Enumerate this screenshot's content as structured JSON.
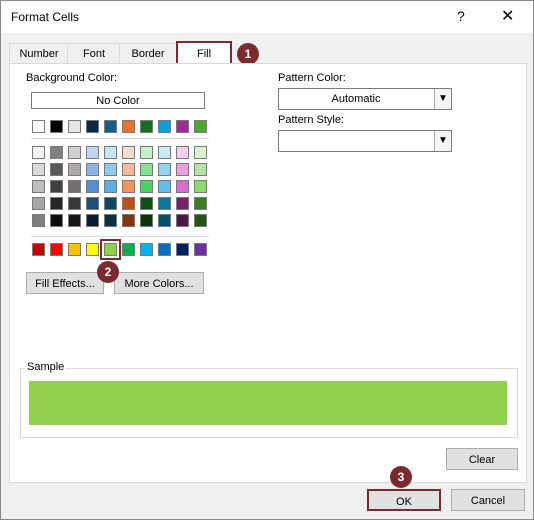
{
  "dialog": {
    "title": "Format Cells",
    "help": "?",
    "close": "✕"
  },
  "tabs": [
    {
      "label": "Number"
    },
    {
      "label": "Font"
    },
    {
      "label": "Border"
    },
    {
      "label": "Fill",
      "active": true
    }
  ],
  "fill": {
    "background_color_label": "Background Color:",
    "no_color_label": "No Color",
    "fill_effects_label": "Fill Effects...",
    "more_colors_label": "More Colors...",
    "pattern_color_label": "Pattern Color:",
    "pattern_color_value": "Automatic",
    "pattern_style_label": "Pattern Style:",
    "pattern_style_value": "",
    "selected_color": "#92d050"
  },
  "palette": {
    "theme_top": [
      "#ffffff",
      "#000000",
      "#e7e6e6",
      "#44546a",
      "#4472c4",
      "#ed7d31",
      "#a5a5a5",
      "#ffc000",
      "#5b9bd5",
      "#70ad47"
    ],
    "theme_top_actual": [
      "#ffffff",
      "#000000",
      "#e7e6e6",
      "#0e2841",
      "#156082",
      "#e97132",
      "#196b24",
      "#0f9ed5",
      "#a02b93",
      "#4ea72e"
    ],
    "theme_grid": [
      [
        "#f2f2f2",
        "#808080",
        "#d0d0d0",
        "#c0d6f0",
        "#c6e4f4",
        "#fbdccf",
        "#c2f0c8",
        "#cbe9f7",
        "#f2cfee",
        "#d9f2d0"
      ],
      [
        "#d9d9d9",
        "#595959",
        "#aeaaaa",
        "#8db3e2",
        "#8ecaec",
        "#f7b99d",
        "#85e194",
        "#96d3f0",
        "#e59edf",
        "#b4e5a1"
      ],
      [
        "#bfbfbf",
        "#404040",
        "#757070",
        "#548dd4",
        "#5aafe0",
        "#f2955c",
        "#49d35e",
        "#60bee9",
        "#d86dcb",
        "#8ed873"
      ],
      [
        "#a6a6a6",
        "#262626",
        "#3a3838",
        "#1f4e79",
        "#0f4761",
        "#c04f15",
        "#134f1b",
        "#0b769f",
        "#782170",
        "#3b7d23"
      ],
      [
        "#7f7f7f",
        "#0d0d0d",
        "#171616",
        "#0e1a2e",
        "#0a2f40",
        "#803410",
        "#0d3512",
        "#074f6a",
        "#501549",
        "#275317"
      ]
    ],
    "standard": [
      "#c00000",
      "#ff0000",
      "#ffc000",
      "#ffff00",
      "#92d050",
      "#00b050",
      "#00b0f0",
      "#0070c0",
      "#002060",
      "#7030a0"
    ]
  },
  "sample": {
    "label": "Sample",
    "color": "#92d050"
  },
  "buttons": {
    "clear": "Clear",
    "ok": "OK",
    "cancel": "Cancel"
  },
  "markers": [
    "1",
    "2",
    "3"
  ]
}
